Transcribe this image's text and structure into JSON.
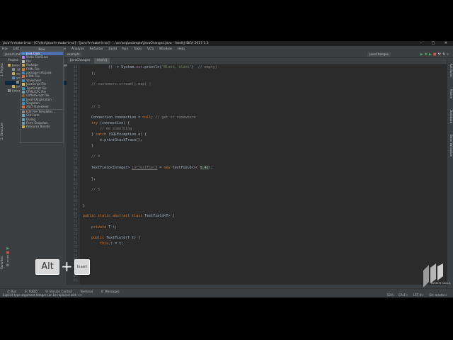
{
  "window": {
    "title": "java-fr-make-it-so - [C:\\dev\\java-fr-make-it-so] - [java-fr-make-it-so] - ...\\src\\org\\example\\JavaChanges.java - IntelliJ IDEA 2017.1.3",
    "controls": "–  ▢  ✕"
  },
  "menu": [
    "File",
    "Edit",
    "View",
    "Navigate",
    "Code",
    "Analyze",
    "Refactor",
    "Build",
    "Run",
    "Tools",
    "VCS",
    "Window",
    "Help"
  ],
  "navbar": {
    "crumbs": [
      "java-fr-make-it-so",
      "src",
      "org",
      "example"
    ],
    "run_config": "JavaChanges"
  },
  "left_tabs": [
    "1: Project",
    "2: Structure",
    "Favorites"
  ],
  "right_tabs": [
    "Ant Build",
    "Maven",
    "Database",
    "Bean Validation"
  ],
  "project": {
    "header": "Project",
    "tree": [
      {
        "label": "java-fr-make-it-so  C:\\dev\\java-fr-make",
        "indent": 4,
        "icon": "#c9a84a"
      },
      {
        "label": ".idea",
        "indent": 10,
        "icon": "#8c8c8c"
      },
      {
        "label": "out",
        "indent": 10,
        "icon": "#c9a84a"
      },
      {
        "label": "src",
        "indent": 10,
        "icon": "#4b8ec6"
      },
      {
        "label": "org.example",
        "indent": 16,
        "icon": "#8c8c8c"
      },
      {
        "label": "java-fr-make-it-so.iml",
        "indent": 10,
        "icon": "#c9a84a"
      },
      {
        "label": "External Libraries",
        "indent": 4,
        "icon": "#8c8c8c"
      }
    ]
  },
  "new_popup": {
    "title": "New",
    "items": [
      {
        "label": "Java Class",
        "icon": "#3592c4"
      },
      {
        "label": "Kotlin File/Class",
        "icon": "#a97bff"
      },
      {
        "label": "File",
        "icon": "#bbbbbb"
      },
      {
        "label": "Package",
        "icon": "#c9a84a"
      },
      {
        "label": "FXML File",
        "icon": "#d07a2f"
      },
      {
        "label": "package-info.java",
        "icon": "#3592c4"
      },
      {
        "label": "HTML File",
        "icon": "#e06c3c"
      },
      {
        "label": "Stylesheet",
        "icon": "#4b8ec6"
      },
      {
        "label": "JavaScript File",
        "icon": "#d8c04a"
      },
      {
        "label": "TypeScript File",
        "icon": "#3592c4"
      },
      {
        "label": "CFML/CFC File",
        "icon": "#6a9fb5"
      },
      {
        "label": "CoffeeScript File",
        "icon": "#8b5a2b"
      },
      {
        "label": "JavaFXApplication",
        "icon": "#3592c4"
      },
      {
        "label": "Singleton",
        "icon": "#3592c4"
      },
      {
        "label": "XSLT Stylesheet",
        "icon": "#e06c3c"
      },
      {
        "label": "Edit File Templates...",
        "icon": "#8c8c8c"
      },
      {
        "label": "GUI Form",
        "icon": "#6a9fb5"
      },
      {
        "label": "Dialog",
        "icon": "#6a9fb5"
      },
      {
        "label": "Form Snapshot",
        "icon": "#6a9fb5"
      },
      {
        "label": "Resource Bundle",
        "icon": "#c9a84a"
      }
    ]
  },
  "editor": {
    "tabs": [
      "JavaChanges",
      "main()"
    ],
    "line_numbers": [
      "34",
      "35",
      "36",
      "37",
      "38",
      "39",
      "40",
      "41",
      "42",
      "43",
      "44",
      "45",
      "46",
      "47",
      "48",
      "49",
      "50",
      "51",
      "52",
      "53",
      "54",
      "55",
      "56",
      "57",
      "58",
      "59",
      "60",
      "61",
      "62",
      "63",
      "64",
      "65",
      "66",
      "67",
      "68",
      "69",
      "70",
      "71",
      "72",
      "73",
      "74",
      "75",
      "76",
      "77",
      "78",
      "79",
      "80",
      "81",
      "82",
      "83",
      "84",
      "85"
    ]
  },
  "bottom_tabs": [
    "4: Run",
    "6: TODO",
    "9: Version Control",
    "Terminal",
    "0: Messages"
  ],
  "status": {
    "message": "Explicit type argument Integer can be replaced with <>",
    "position": "53:6",
    "line_sep": "CRLF÷",
    "encoding": "UTF-8÷",
    "git": "Git: master÷"
  },
  "keys": {
    "alt": "Alt",
    "plus": "+",
    "insert": "Insert"
  },
  "logo": {
    "text": "INFINITE SKILLS"
  },
  "colors": {
    "bg": "#2b2b2b",
    "panel": "#3c3f41",
    "selection": "#4b6eaf",
    "keyword": "#cc7832"
  }
}
